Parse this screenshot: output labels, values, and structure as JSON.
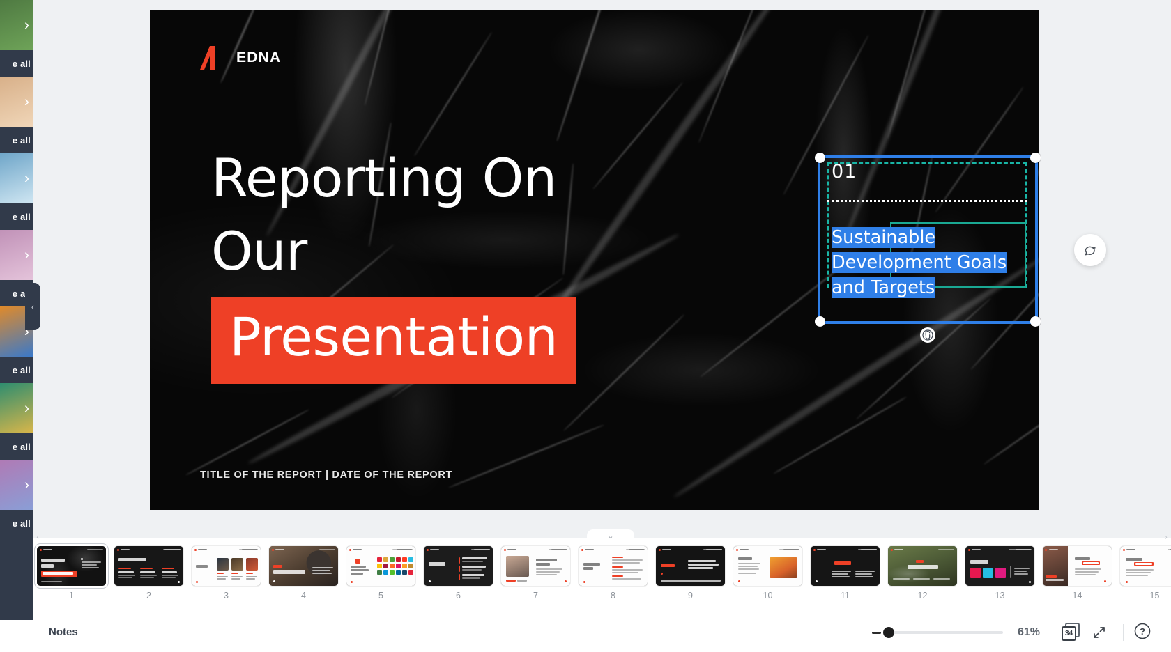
{
  "app": {
    "accent_red": "#ee4026",
    "selection_blue": "#2f7fe8",
    "guide_teal": "#19b5a6",
    "rail_bg": "#313a4a"
  },
  "left_rail": {
    "see_all_label": "e all",
    "collapse_icon": "‹",
    "chevron_icon": "›",
    "groups": [
      {
        "chevron": "›",
        "see_all": "e all"
      },
      {
        "chevron": "›",
        "see_all": "e all"
      },
      {
        "chevron": "›",
        "see_all": "e all"
      },
      {
        "chevron": "›",
        "see_all": "e all"
      },
      {
        "chevron": "›",
        "see_all": "e all"
      },
      {
        "chevron": "›",
        "see_all": "e all"
      },
      {
        "chevron": "›",
        "see_all": "e all"
      }
    ]
  },
  "slide": {
    "logo_text": "EDNA",
    "title_line_1": "Reporting On",
    "title_line_2": "Our",
    "title_highlight": "Presentation",
    "footer": "TITLE OF THE REPORT  |  DATE OF THE REPORT"
  },
  "selection": {
    "number": "01",
    "body_text": "Sustainable Development Goals and Targets",
    "body_line_1": "Sustainable",
    "body_line_2": "Development Goals",
    "body_line_3": "and Targets",
    "rotate_icon": "rotate-icon",
    "comment_icon": "add-comment-icon"
  },
  "filmstrip": {
    "collapse_icon": "⌄",
    "selected_index": 1,
    "slides": [
      {
        "num": "1",
        "kind": "title-dark"
      },
      {
        "num": "2",
        "kind": "dark-three-col"
      },
      {
        "num": "3",
        "kind": "light-authors"
      },
      {
        "num": "4",
        "kind": "photo-bear"
      },
      {
        "num": "5",
        "kind": "light-sdg-grid"
      },
      {
        "num": "6",
        "kind": "dark-objectives"
      },
      {
        "num": "7",
        "kind": "light-portrait"
      },
      {
        "num": "8",
        "kind": "light-two-col"
      },
      {
        "num": "9",
        "kind": "dark-impact-1"
      },
      {
        "num": "10",
        "kind": "light-impact-2"
      },
      {
        "num": "11",
        "kind": "dark-impact-3"
      },
      {
        "num": "12",
        "kind": "photo-prioritizing"
      },
      {
        "num": "13",
        "kind": "dark-study-sdg"
      },
      {
        "num": "14",
        "kind": "split-photo-card"
      },
      {
        "num": "15",
        "kind": "light-card"
      }
    ]
  },
  "notes_bar": {
    "notes_label": "Notes",
    "zoom_percent": "61%",
    "slide_count": "34",
    "minus_icon": "minus-icon",
    "slides_icon": "slides-count-icon",
    "expand_icon": "expand-icon",
    "help_icon": "help-icon"
  },
  "scroll": {
    "left_arrow": "‹",
    "right_arrow": "›"
  }
}
